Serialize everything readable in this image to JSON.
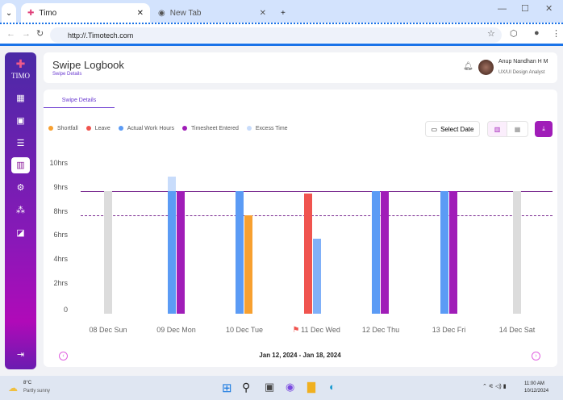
{
  "browser": {
    "tabs": [
      {
        "label": "Timo",
        "active": true
      },
      {
        "label": "New Tab",
        "active": false
      }
    ],
    "url": "http://.Timotech.com"
  },
  "sidebar": {
    "logo": "TIMO",
    "items": [
      "dashboard-icon",
      "timesheet-icon",
      "report-icon",
      "chart-icon",
      "settings-icon",
      "team-icon",
      "analytics-icon"
    ],
    "active": 3
  },
  "header": {
    "title": "Swipe Logbook",
    "subtitle": "Swipe Details",
    "user_name": "Anup Nandhan H M",
    "user_role": "UX/UI Design Analyst"
  },
  "tabs": [
    {
      "label": "Swipe Details"
    }
  ],
  "toolbar": {
    "select_date": "Select Date"
  },
  "footer": {
    "range": "Jan 12, 2024 - Jan 18, 2024"
  },
  "taskbar": {
    "temp": "8°C",
    "weather": "Partly sunny",
    "time": "11:00 AM",
    "date": "10/12/2024"
  },
  "colors": {
    "shortfall": "#f7a030",
    "leave": "#f0544f",
    "actual": "#5b9bf5",
    "timesheet": "#a01db8",
    "excess": "#c8dcfb",
    "weekend": "#dcdcdc"
  },
  "chart_data": {
    "type": "bar",
    "legend": [
      "Shortfall",
      "Leave",
      "Actual Work Hours",
      "Timesheet Entered",
      "Excess Time"
    ],
    "ytick_labels": [
      "10hrs",
      "9hrs",
      "8hrs",
      "6hrs",
      "4hrs",
      "2hrs",
      "0"
    ],
    "ytick_values": [
      10,
      9,
      8,
      6,
      4,
      2,
      0
    ],
    "categories": [
      "08 Dec Sun",
      "09 Dec Mon",
      "10 Dec Tue",
      "11 Dec Wed",
      "12 Dec Thu",
      "13 Dec Fri",
      "14 Dec Sat"
    ],
    "flagged_category": "11 Dec Wed",
    "target_line": 9,
    "min_line": 8,
    "bars": [
      [
        {
          "series": "weekend",
          "value": 9
        }
      ],
      [
        {
          "series": "actual",
          "value": 9,
          "excess": 9.6
        },
        {
          "series": "timesheet",
          "value": 9
        }
      ],
      [
        {
          "series": "actual",
          "value": 9
        },
        {
          "series": "shortfall",
          "value": 8
        }
      ],
      [
        {
          "series": "leave",
          "value": 8.9
        },
        {
          "series": "actual_light",
          "value": 6
        }
      ],
      [
        {
          "series": "actual",
          "value": 9
        },
        {
          "series": "timesheet",
          "value": 9
        }
      ],
      [
        {
          "series": "actual",
          "value": 9
        },
        {
          "series": "timesheet",
          "value": 9
        }
      ],
      [
        {
          "series": "weekend",
          "value": 9
        }
      ]
    ]
  }
}
